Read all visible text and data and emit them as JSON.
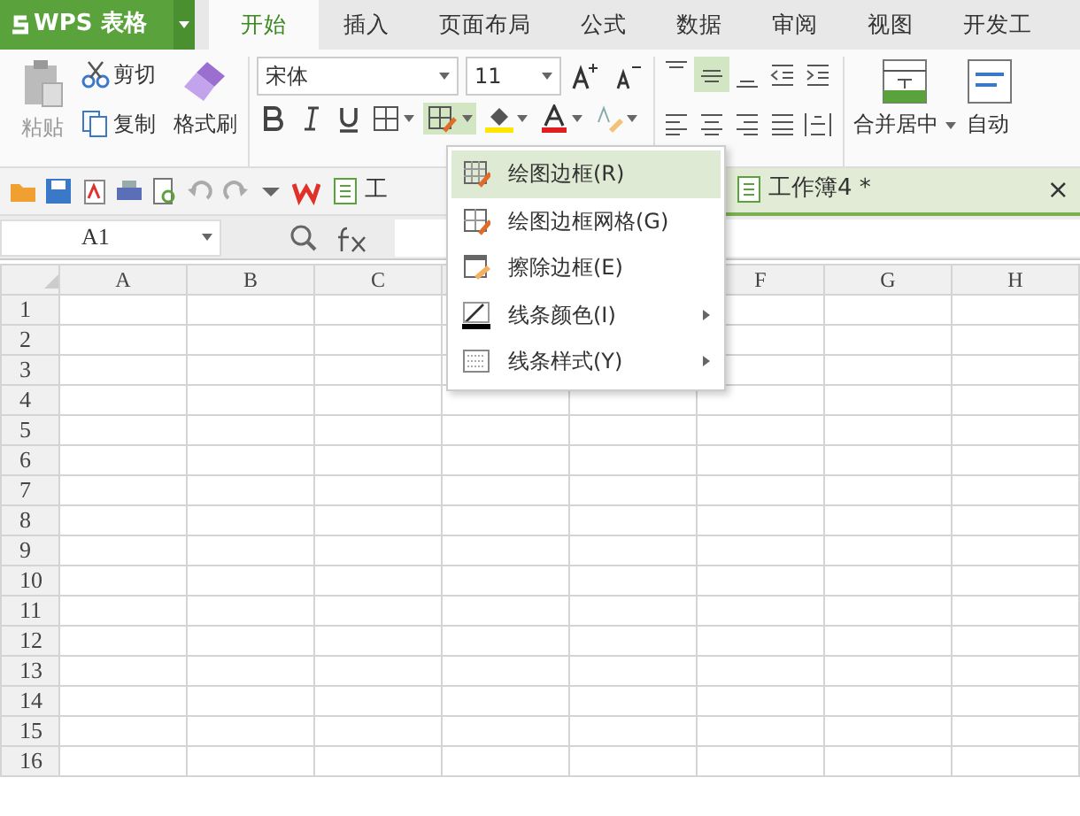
{
  "app": {
    "title": "WPS 表格"
  },
  "ribbon_tabs": [
    {
      "label": "开始",
      "selected": true
    },
    {
      "label": "插入",
      "selected": false
    },
    {
      "label": "页面布局",
      "selected": false
    },
    {
      "label": "公式",
      "selected": false
    },
    {
      "label": "数据",
      "selected": false
    },
    {
      "label": "审阅",
      "selected": false
    },
    {
      "label": "视图",
      "selected": false
    },
    {
      "label": "开发工",
      "selected": false
    }
  ],
  "clipboard": {
    "paste": "粘贴",
    "cut": "剪切",
    "copy": "复制",
    "format_painter": "格式刷"
  },
  "font": {
    "name": "宋体",
    "size": "11"
  },
  "align_top": [
    {
      "kind": "top",
      "selected": false
    },
    {
      "kind": "middle",
      "selected": true
    },
    {
      "kind": "bottom",
      "selected": false
    },
    {
      "kind": "outdent",
      "selected": false
    },
    {
      "kind": "indent",
      "selected": false
    }
  ],
  "align_bottom": [
    {
      "kind": "left",
      "selected": false
    },
    {
      "kind": "center",
      "selected": false
    },
    {
      "kind": "right",
      "selected": false
    },
    {
      "kind": "justify",
      "selected": false
    },
    {
      "kind": "distribute",
      "selected": false
    }
  ],
  "border_button": {
    "pressed": true
  },
  "merge": {
    "label": "合并居中"
  },
  "wrap": {
    "label": "自动"
  },
  "doc_tabs": [
    {
      "title": "工",
      "selected": false
    },
    {
      "title": "工作簿4 *",
      "selected": true,
      "close": "×"
    }
  ],
  "name_box": {
    "value": "A1"
  },
  "columns_left": [
    "A",
    "B",
    "C"
  ],
  "columns_right": [
    "F",
    "G",
    "H"
  ],
  "rows": [
    "1",
    "2",
    "3",
    "4",
    "5",
    "6",
    "7",
    "8",
    "9",
    "10",
    "11",
    "12",
    "13",
    "14",
    "15",
    "16"
  ],
  "border_menu": [
    {
      "label": "绘图边框(R)",
      "kind": "draw",
      "selected": true,
      "submenu": false
    },
    {
      "label": "绘图边框网格(G)",
      "kind": "grid",
      "selected": false,
      "submenu": false
    },
    {
      "label": "擦除边框(E)",
      "kind": "erase",
      "selected": false,
      "submenu": false
    },
    {
      "label": "线条颜色(I)",
      "kind": "color",
      "selected": false,
      "submenu": true
    },
    {
      "label": "线条样式(Y)",
      "kind": "style",
      "selected": false,
      "submenu": true
    }
  ]
}
